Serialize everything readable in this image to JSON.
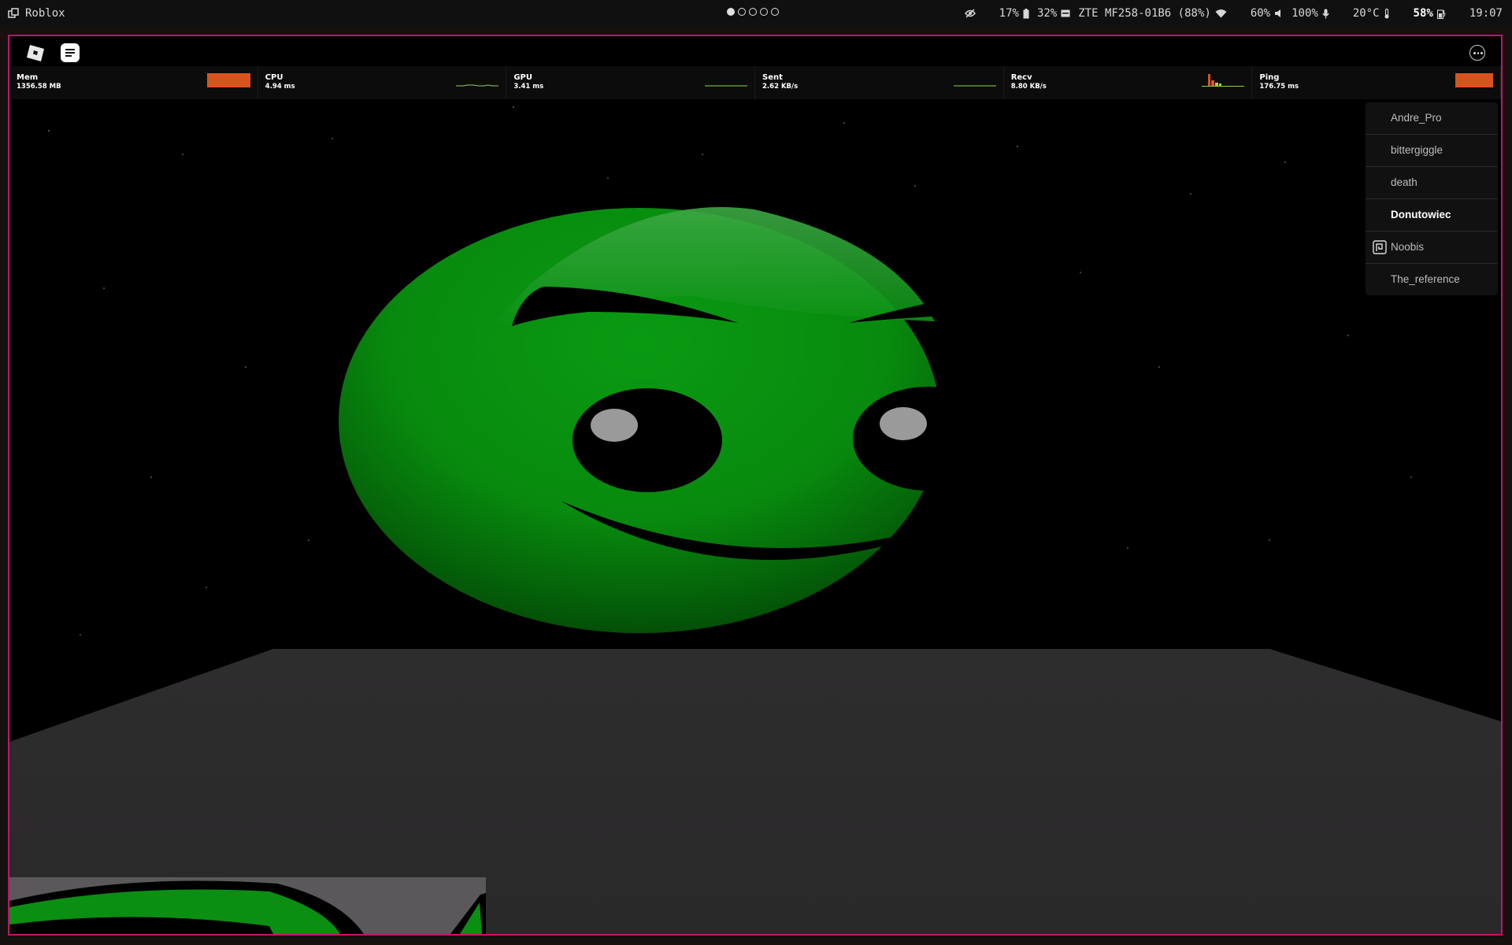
{
  "topbar": {
    "app_title": "Roblox",
    "workspaces": [
      1,
      2,
      3,
      4,
      5
    ],
    "active_workspace": 1,
    "status": {
      "eye": "17%",
      "battery_device": "32%",
      "network_name": "ZTE MF258-01B6 (88%)",
      "brightness": "60%",
      "volume": "100%",
      "temperature": "20°C",
      "battery": "58%",
      "clock": "19:07"
    }
  },
  "stats": [
    {
      "name": "Mem",
      "value": "1356.58 MB"
    },
    {
      "name": "CPU",
      "value": "4.94 ms"
    },
    {
      "name": "GPU",
      "value": "3.41 ms"
    },
    {
      "name": "Sent",
      "value": "2.62 KB/s"
    },
    {
      "name": "Recv",
      "value": "8.80 KB/s"
    },
    {
      "name": "Ping",
      "value": "176.75 ms"
    }
  ],
  "players": [
    {
      "name": "Andre_Pro"
    },
    {
      "name": "bittergiggle"
    },
    {
      "name": "death"
    },
    {
      "name": "Donutowiec"
    },
    {
      "name": "Noobis"
    },
    {
      "name": "The_reference"
    }
  ],
  "colors": {
    "accent_border": "#c4126b",
    "stat_bar": "#d9531e",
    "graph_line": "#8fd33a",
    "face_green": "#08900e"
  },
  "icons": [
    "window-icon",
    "roblox-logo-icon",
    "chat-icon",
    "more-icon",
    "eye-icon",
    "battery-icon",
    "drive-icon",
    "wifi-icon",
    "volume-icon",
    "mic-icon",
    "player-badge-icon"
  ]
}
